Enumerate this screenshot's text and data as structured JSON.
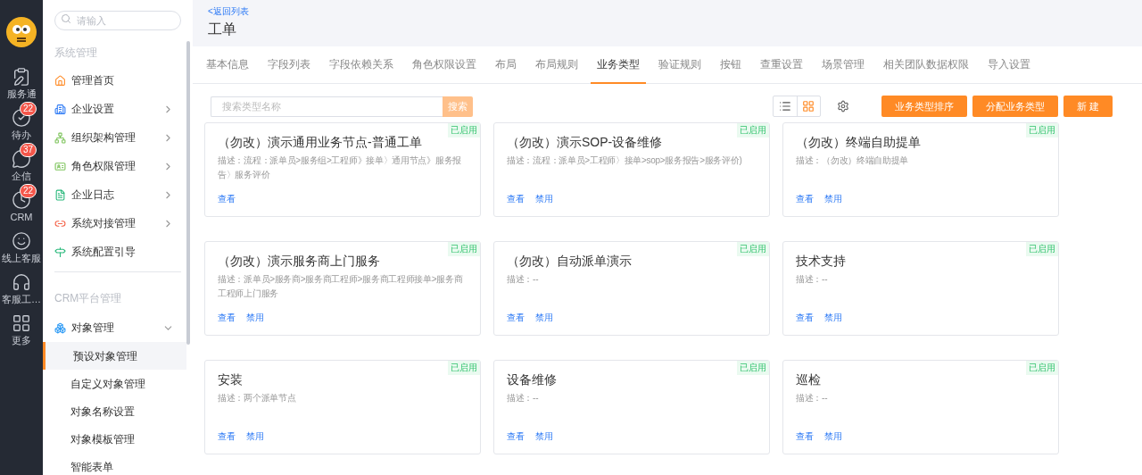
{
  "rail": [
    {
      "label": "服务通"
    },
    {
      "label": "待办",
      "badge": "22"
    },
    {
      "label": "企信",
      "badge": "37"
    },
    {
      "label": "CRM",
      "badge": "22"
    },
    {
      "label": "线上客服"
    },
    {
      "label": "客服工…"
    },
    {
      "label": "更多"
    }
  ],
  "sidebar": {
    "search_placeholder": "请输入",
    "sections": [
      {
        "title": "系统管理",
        "items": [
          {
            "label": "管理首页",
            "selected": false
          },
          {
            "label": "企业设置",
            "expandable": true,
            "expanded": false,
            "selected": false
          },
          {
            "label": "组织架构管理",
            "expandable": true,
            "expanded": false,
            "selected": false
          },
          {
            "label": "角色权限管理",
            "expandable": true,
            "expanded": false,
            "selected": false
          },
          {
            "label": "企业日志",
            "expandable": true,
            "expanded": false,
            "selected": false
          },
          {
            "label": "系统对接管理",
            "expandable": true,
            "expanded": false,
            "selected": false
          },
          {
            "label": "系统配置引导",
            "selected": false
          }
        ]
      },
      {
        "title": "CRM平台管理",
        "items": [
          {
            "label": "对象管理",
            "expandable": true,
            "expanded": true,
            "selected": false,
            "children": [
              {
                "label": "预设对象管理",
                "selected": true
              },
              {
                "label": "自定义对象管理",
                "selected": false
              },
              {
                "label": "对象名称设置",
                "selected": false
              },
              {
                "label": "对象模板管理",
                "selected": false
              },
              {
                "label": "智能表单",
                "selected": false
              }
            ]
          }
        ]
      }
    ]
  },
  "header": {
    "back_link": "<返回列表",
    "title": "工单"
  },
  "tabs": [
    {
      "label": "基本信息",
      "selected": false
    },
    {
      "label": "字段列表",
      "selected": false
    },
    {
      "label": "字段依赖关系",
      "selected": false
    },
    {
      "label": "角色权限设置",
      "selected": false
    },
    {
      "label": "布局",
      "selected": false
    },
    {
      "label": "布局规则",
      "selected": false
    },
    {
      "label": "业务类型",
      "selected": true
    },
    {
      "label": "验证规则",
      "selected": false
    },
    {
      "label": "按钮",
      "selected": false
    },
    {
      "label": "查重设置",
      "selected": false
    },
    {
      "label": "场景管理",
      "selected": false
    },
    {
      "label": "相关团队数据权限",
      "selected": false
    },
    {
      "label": "导入设置",
      "selected": false
    }
  ],
  "toolbar": {
    "search_placeholder": "搜索类型名称",
    "search_button": "搜索",
    "view_toggle": [
      {
        "kind": "list",
        "selected": false
      },
      {
        "kind": "grid",
        "selected": true
      }
    ],
    "buttons": [
      "业务类型排序",
      "分配业务类型",
      "新 建"
    ]
  },
  "cards": [
    {
      "title": "（勿改）演示通用业务节点-普通工单",
      "description": "描述：流程：派单员>服务组>工程师》接单〉通用节点》服务报告〉服务评价",
      "status": "已启用",
      "actions": [
        "查看"
      ]
    },
    {
      "title": "（勿改）演示SOP-设备维修",
      "description": "描述：流程：派单员>工程师〉接单>sop>服务报告>服务评价)",
      "status": "已启用",
      "actions": [
        "查看",
        "禁用"
      ]
    },
    {
      "title": "（勿改）终端自助提单",
      "description": "描述：（勿改）终端自助提单",
      "status": "已启用",
      "actions": [
        "查看",
        "禁用"
      ]
    },
    {
      "title": "（勿改）演示服务商上门服务",
      "description": "描述：派单员>服务商>服务商工程师>服务商工程师接单>服务商工程师上门服务",
      "status": "已启用",
      "actions": [
        "查看",
        "禁用"
      ]
    },
    {
      "title": "（勿改）自动派单演示",
      "description": "描述：--",
      "status": "已启用",
      "actions": [
        "查看",
        "禁用"
      ]
    },
    {
      "title": "技术支持",
      "description": "描述：--",
      "status": "已启用",
      "actions": [
        "查看",
        "禁用"
      ]
    },
    {
      "title": "安装",
      "description": "描述：两个派单节点",
      "status": "已启用",
      "actions": [
        "查看",
        "禁用"
      ]
    },
    {
      "title": "设备维修",
      "description": "描述：--",
      "status": "已启用",
      "actions": [
        "查看",
        "禁用"
      ]
    },
    {
      "title": "巡检",
      "description": "描述：--",
      "status": "已启用",
      "actions": [
        "查看",
        "禁用"
      ]
    }
  ]
}
